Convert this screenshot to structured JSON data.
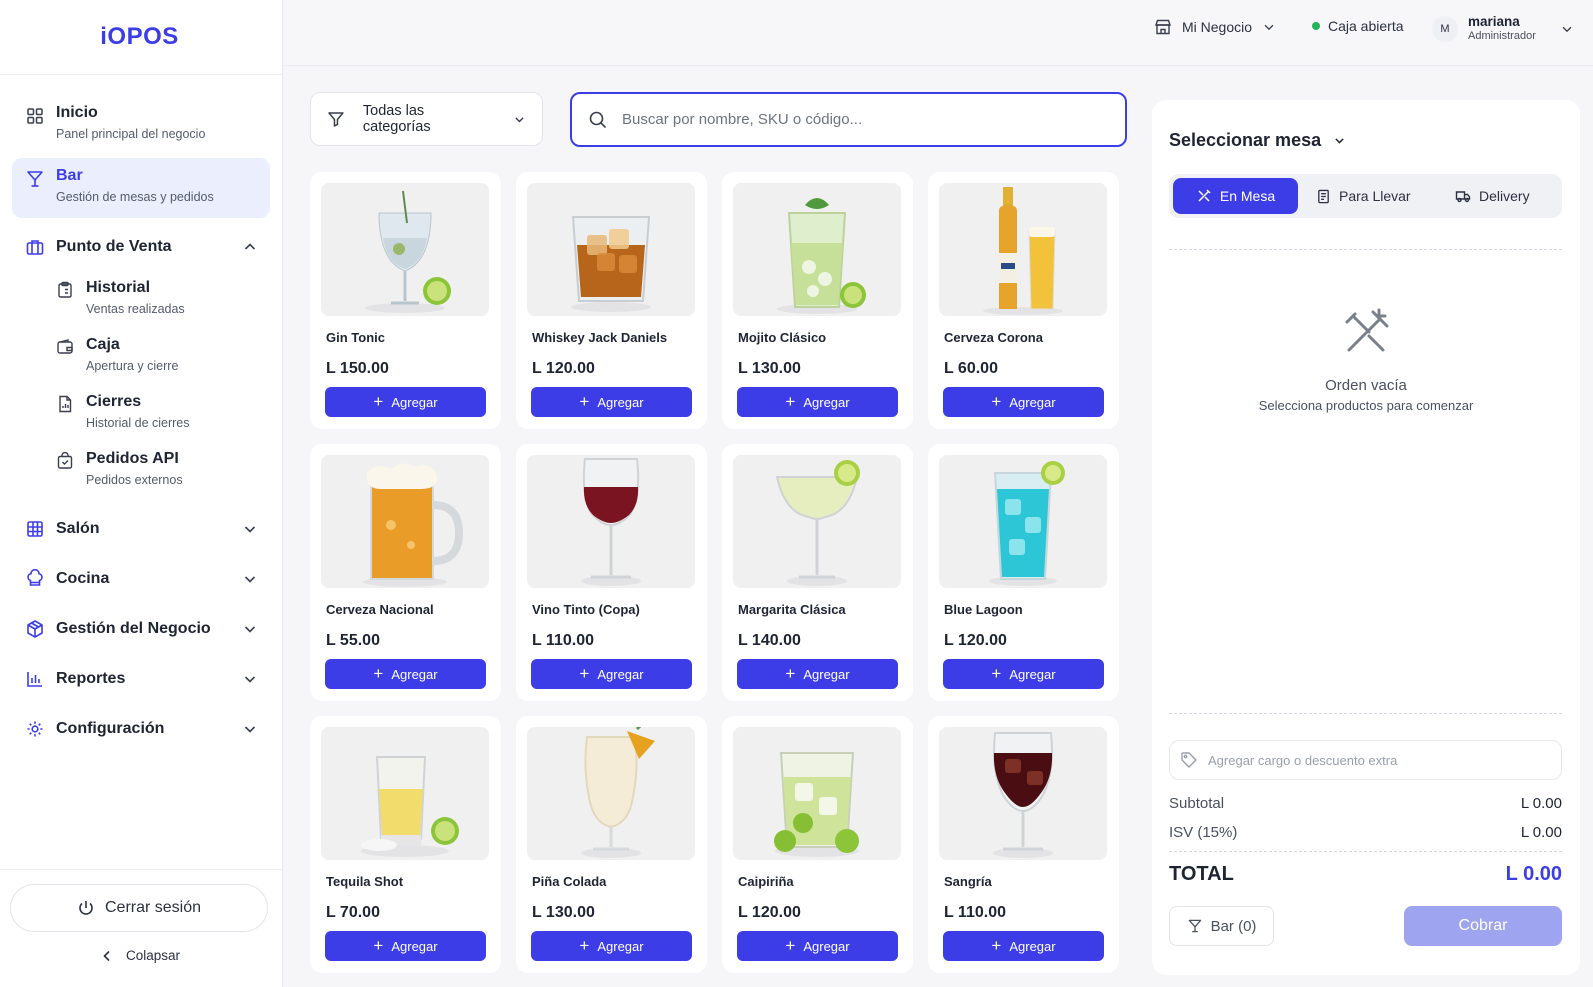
{
  "brand": {
    "logo": "iOPOS"
  },
  "sidebar": {
    "items": [
      {
        "label": "Inicio",
        "sub": "Panel principal del negocio"
      },
      {
        "label": "Bar",
        "sub": "Gestión de mesas y pedidos"
      }
    ],
    "pos": {
      "label": "Punto de Venta",
      "children": [
        {
          "label": "Historial",
          "sub": "Ventas realizadas"
        },
        {
          "label": "Caja",
          "sub": "Apertura y cierre"
        },
        {
          "label": "Cierres",
          "sub": "Historial de cierres"
        },
        {
          "label": "Pedidos API",
          "sub": "Pedidos externos"
        }
      ]
    },
    "sections": [
      {
        "label": "Salón"
      },
      {
        "label": "Cocina"
      },
      {
        "label": "Gestión del Negocio"
      },
      {
        "label": "Reportes"
      },
      {
        "label": "Configuración"
      }
    ],
    "logout": "Cerrar sesión",
    "collapse": "Colapsar"
  },
  "topbar": {
    "business": "Mi Negocio",
    "status": "Caja abierta",
    "status_color": "#1fb35a",
    "avatar_initial": "M",
    "user_name": "mariana",
    "user_role": "Administrador"
  },
  "filters": {
    "category": "Todas las categorías",
    "search_placeholder": "Buscar por nombre, SKU o código..."
  },
  "products": [
    {
      "name": "Gin Tonic",
      "price": "L 150.00",
      "cta": "Agregar"
    },
    {
      "name": "Whiskey Jack Daniels",
      "price": "L 120.00",
      "cta": "Agregar"
    },
    {
      "name": "Mojito Clásico",
      "price": "L 130.00",
      "cta": "Agregar"
    },
    {
      "name": "Cerveza Corona",
      "price": "L 60.00",
      "cta": "Agregar"
    },
    {
      "name": "Cerveza Nacional",
      "price": "L 55.00",
      "cta": "Agregar"
    },
    {
      "name": "Vino Tinto (Copa)",
      "price": "L 110.00",
      "cta": "Agregar"
    },
    {
      "name": "Margarita Clásica",
      "price": "L 140.00",
      "cta": "Agregar"
    },
    {
      "name": "Blue Lagoon",
      "price": "L 120.00",
      "cta": "Agregar"
    },
    {
      "name": "Tequila Shot",
      "price": "L 70.00",
      "cta": "Agregar"
    },
    {
      "name": "Piña Colada",
      "price": "L 130.00",
      "cta": "Agregar"
    },
    {
      "name": "Caipiriña",
      "price": "L 120.00",
      "cta": "Agregar"
    },
    {
      "name": "Sangría",
      "price": "L 110.00",
      "cta": "Agregar"
    }
  ],
  "order": {
    "table_select": "Seleccionar mesa",
    "modes": [
      "En Mesa",
      "Para Llevar",
      "Delivery"
    ],
    "empty_title": "Orden vacía",
    "empty_sub": "Selecciona productos para comenzar",
    "extra_placeholder": "Agregar cargo o descuento extra",
    "subtotal_label": "Subtotal",
    "subtotal_value": "L 0.00",
    "tax_label": "ISV (15%)",
    "tax_value": "L 0.00",
    "total_label": "TOTAL",
    "total_value": "L 0.00",
    "bar_button": "Bar (0)",
    "pay_button": "Cobrar"
  },
  "colors": {
    "accent": "#3d3de8",
    "accent_soft": "#eaeefd",
    "pay_disabled": "#9ea4f0"
  }
}
